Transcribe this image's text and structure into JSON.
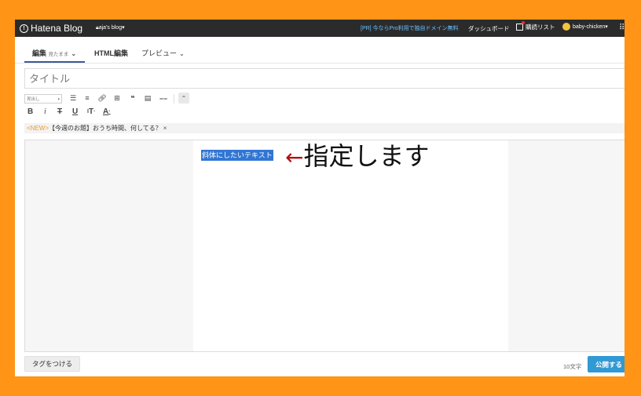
{
  "topbar": {
    "logo_text": "Hatena Blog",
    "blog_name": "aja's blog",
    "promo": "[PR] 今ならPro利用で独自ドメイン無料",
    "dashboard": "ダッシュボード",
    "reading_list": "購読リスト",
    "username": "baby-chicken",
    "menu_icon": "menu-grid-icon"
  },
  "tabs": [
    {
      "label": "編集",
      "sub": "見たまま"
    },
    {
      "label": "HTML編集"
    },
    {
      "label": "プレビュー"
    }
  ],
  "title_placeholder": "タイトル",
  "toolbar": {
    "heading_select": "見出し",
    "icons": [
      "bullet-list-icon",
      "numbered-list-icon",
      "link-icon",
      "table-icon",
      "quote-icon",
      "more-icon",
      "footnote-icon"
    ],
    "format": {
      "bold": "B",
      "italic": "i",
      "strike": "T",
      "underline": "U",
      "size": "T",
      "color": "A"
    }
  },
  "news": {
    "new_label": "<NEW>",
    "text": "【今週のお題】おうち時間、何してる？",
    "close": "×"
  },
  "editor": {
    "selected_text": "斜体にしたいテキスト"
  },
  "annotation": {
    "arrow": "←",
    "text": "指定します"
  },
  "footer": {
    "tag_button": "タグをつける",
    "char_count": "10文字",
    "publish_button": "公開する"
  },
  "colors": {
    "frame_border": "#ff9416",
    "topbar": "#2b2b2b",
    "selection": "#3176d4",
    "publish": "#3199d4",
    "annotation_arrow": "#b21111"
  }
}
